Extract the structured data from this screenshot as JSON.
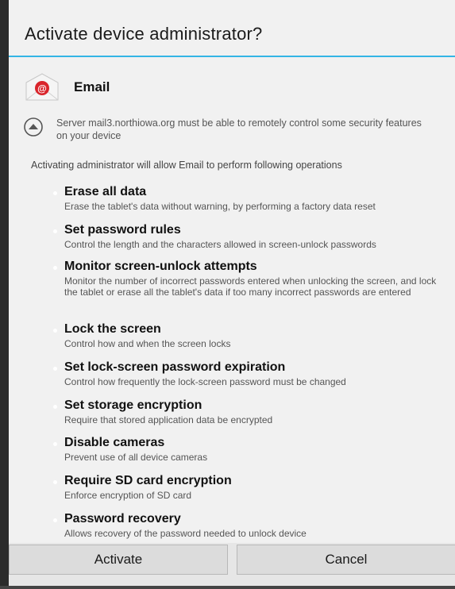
{
  "dialog": {
    "title": "Activate device administrator?"
  },
  "app": {
    "name": "Email",
    "icon": "email-app-icon"
  },
  "notice": {
    "icon": "up-arrow-circle-icon",
    "text": "Server mail3.northiowa.org must be able to remotely control some security features on your device"
  },
  "intro": "Activating administrator will allow Email to perform following operations",
  "permissions": [
    {
      "title": "Erase all data",
      "desc": "Erase the tablet's data without warning, by performing a factory data reset"
    },
    {
      "title": "Set password rules",
      "desc": "Control the length and the characters allowed in screen-unlock passwords"
    },
    {
      "title": "Monitor screen-unlock attempts",
      "desc": "Monitor the number of incorrect passwords entered when unlocking the screen, and lock the tablet or erase all the tablet's data if too many incorrect passwords are entered"
    },
    {
      "title": "Lock the screen",
      "desc": "Control how and when the screen locks"
    },
    {
      "title": "Set lock-screen password expiration",
      "desc": "Control how frequently the lock-screen password must be changed"
    },
    {
      "title": "Set storage encryption",
      "desc": "Require that stored application data be encrypted"
    },
    {
      "title": "Disable cameras",
      "desc": "Prevent use of all device cameras"
    },
    {
      "title": "Require SD card encryption",
      "desc": "Enforce encryption of SD card"
    },
    {
      "title": "Password recovery",
      "desc": "Allows recovery of the password needed to unlock device"
    }
  ],
  "buttons": {
    "activate": "Activate",
    "cancel": "Cancel"
  },
  "colors": {
    "accent": "#33b5e5",
    "background": "#f1f1f1"
  }
}
